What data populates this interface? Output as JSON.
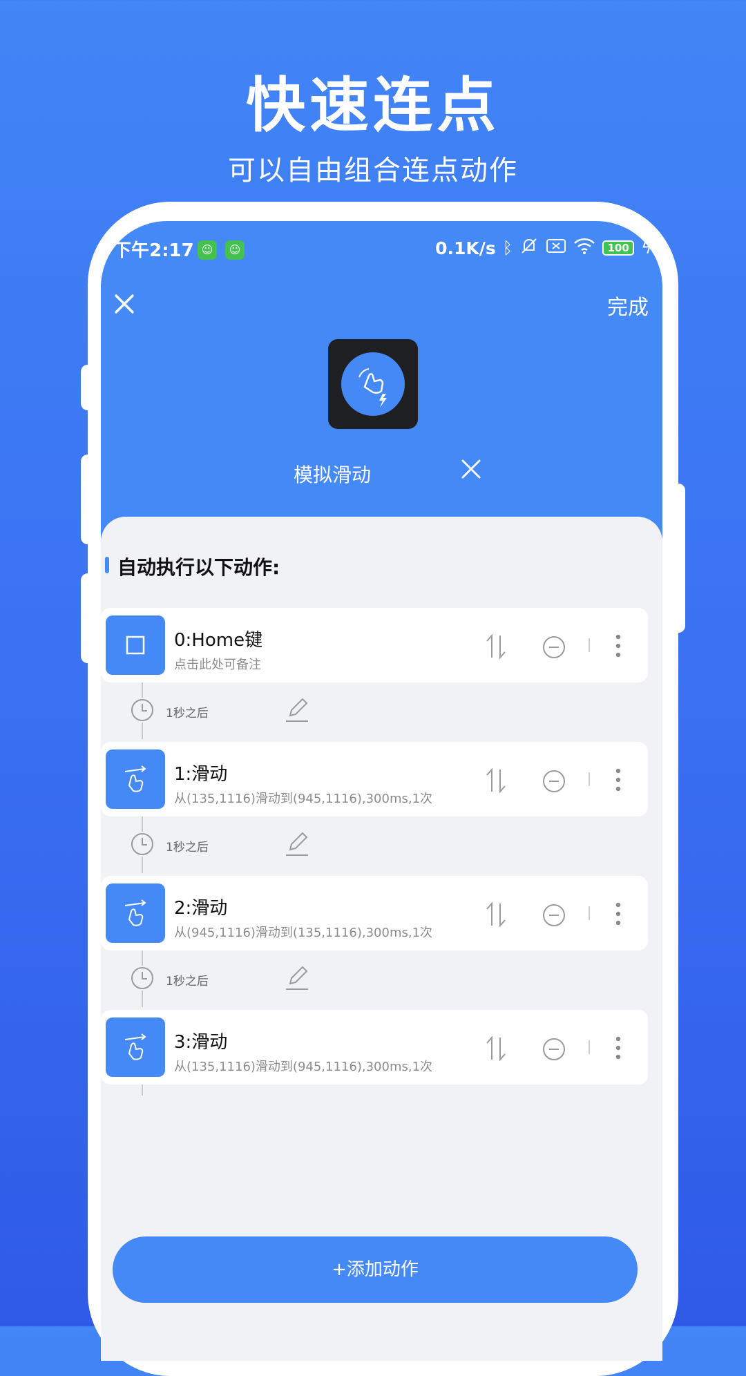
{
  "hero": {
    "title": "快速连点",
    "subtitle": "可以自由组合连点动作"
  },
  "status_bar": {
    "time": "下午2:17",
    "net_speed": "0.1K/s",
    "battery": "100"
  },
  "header": {
    "done_label": "完成"
  },
  "app": {
    "name": "模拟滑动"
  },
  "section": {
    "title": "自动执行以下动作:"
  },
  "actions": [
    {
      "title": "0:Home键",
      "subtitle": "点击此处可备注",
      "icon": "home-square-icon"
    },
    {
      "title": "1:滑动",
      "subtitle": "从(135,1116)滑动到(945,1116),300ms,1次",
      "icon": "swipe-hand-icon"
    },
    {
      "title": "2:滑动",
      "subtitle": "从(945,1116)滑动到(135,1116),300ms,1次",
      "icon": "swipe-hand-icon"
    },
    {
      "title": "3:滑动",
      "subtitle": "从(135,1116)滑动到(945,1116),300ms,1次",
      "icon": "swipe-hand-icon"
    }
  ],
  "delays": [
    {
      "label": "1秒之后"
    },
    {
      "label": "1秒之后"
    },
    {
      "label": "1秒之后"
    }
  ],
  "add_button": {
    "label": "+添加动作"
  },
  "colors": {
    "primary": "#4489f5",
    "background": "#f1f2f5",
    "badge_green": "#43c24f"
  }
}
